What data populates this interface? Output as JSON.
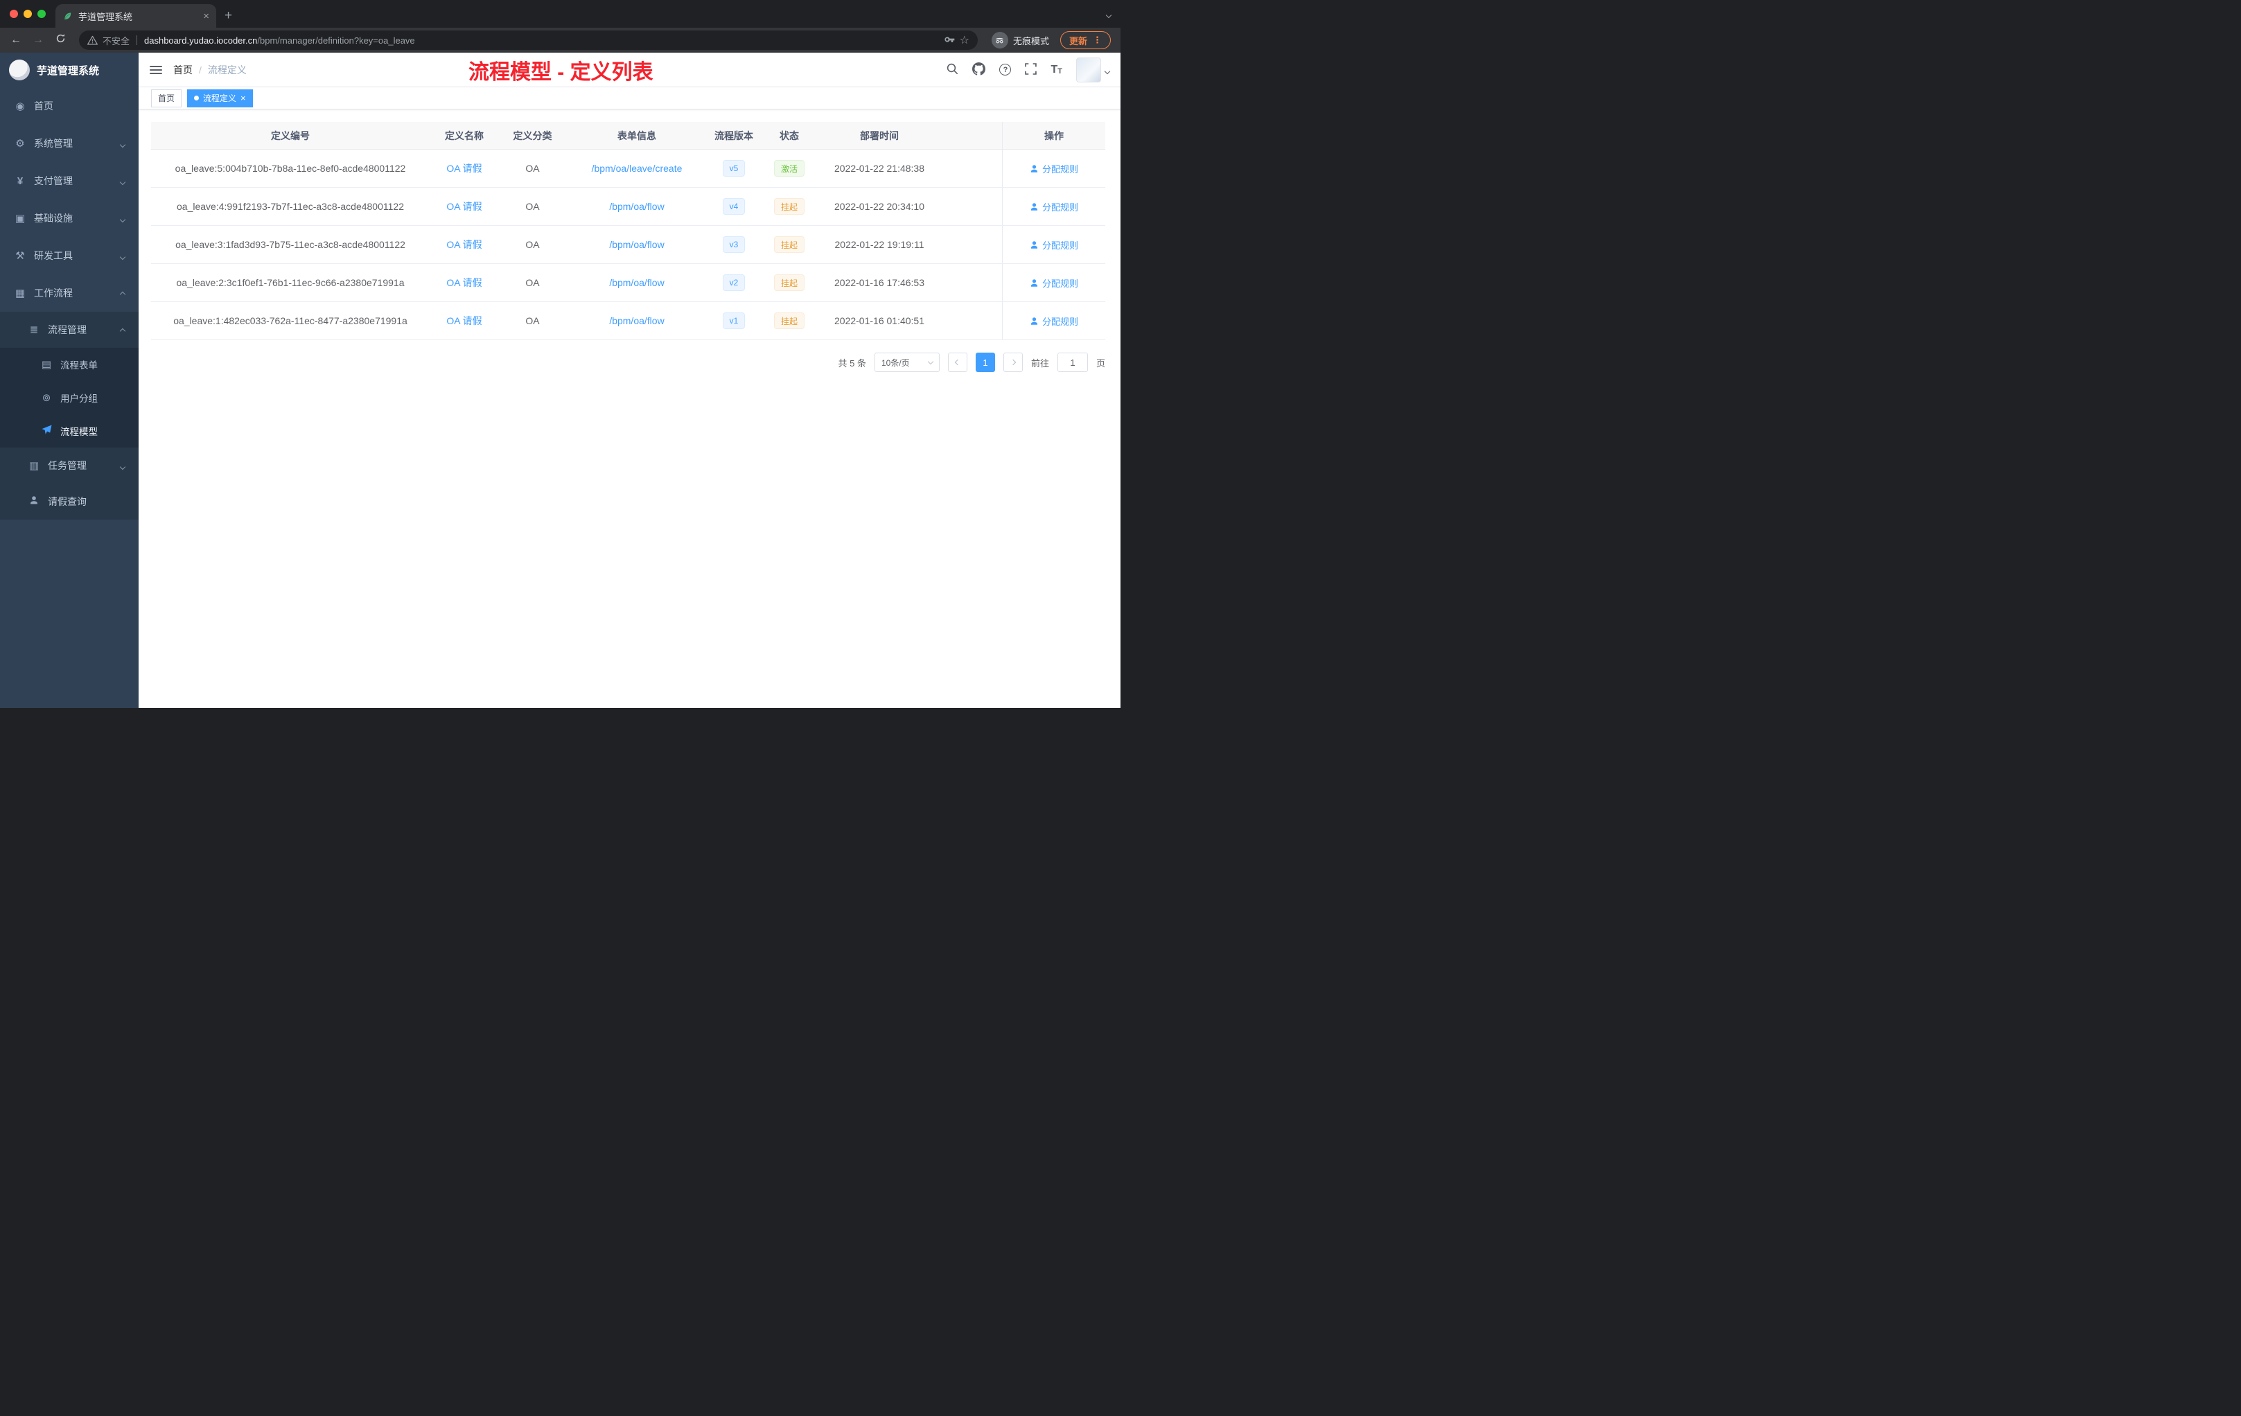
{
  "browser": {
    "tab": {
      "title": "芋道管理系统"
    },
    "address": {
      "security_label": "不安全",
      "url_host": "dashboard.yudao.iocoder.cn",
      "url_path": "/bpm/manager/definition?key=oa_leave",
      "incognito_label": "无痕模式",
      "update_label": "更新"
    }
  },
  "icons": {
    "close": "×",
    "plus": "+",
    "back": "←",
    "forward": "→",
    "star": "☆",
    "dots_vertical": "⋮"
  },
  "sidebar": {
    "logo_title": "芋道管理系统",
    "items": [
      {
        "label": "首页"
      },
      {
        "label": "系统管理"
      },
      {
        "label": "支付管理"
      },
      {
        "label": "基础设施"
      },
      {
        "label": "研发工具"
      },
      {
        "label": "工作流程"
      },
      {
        "label": "流程管理"
      },
      {
        "label": "流程表单"
      },
      {
        "label": "用户分组"
      },
      {
        "label": "流程模型"
      },
      {
        "label": "任务管理"
      },
      {
        "label": "请假查询"
      }
    ]
  },
  "header": {
    "breadcrumb": {
      "home": "首页",
      "separator": "/",
      "current": "流程定义"
    },
    "annotation": "流程模型 - 定义列表"
  },
  "tags": [
    {
      "label": "首页",
      "active": false
    },
    {
      "label": "流程定义",
      "active": true
    }
  ],
  "table": {
    "columns": [
      "定义编号",
      "定义名称",
      "定义分类",
      "表单信息",
      "流程版本",
      "状态",
      "部署时间",
      "操作"
    ],
    "rows": [
      {
        "id": "oa_leave:5:004b710b-7b8a-11ec-8ef0-acde48001122",
        "name": "OA 请假",
        "category": "OA",
        "form": "/bpm/oa/leave/create",
        "version": "v5",
        "status": "激活",
        "status_type": "success",
        "deploy_time": "2022-01-22 21:48:38",
        "action": "分配规则"
      },
      {
        "id": "oa_leave:4:991f2193-7b7f-11ec-a3c8-acde48001122",
        "name": "OA 请假",
        "category": "OA",
        "form": "/bpm/oa/flow",
        "version": "v4",
        "status": "挂起",
        "status_type": "warning",
        "deploy_time": "2022-01-22 20:34:10",
        "action": "分配规则"
      },
      {
        "id": "oa_leave:3:1fad3d93-7b75-11ec-a3c8-acde48001122",
        "name": "OA 请假",
        "category": "OA",
        "form": "/bpm/oa/flow",
        "version": "v3",
        "status": "挂起",
        "status_type": "warning",
        "deploy_time": "2022-01-22 19:19:11",
        "action": "分配规则"
      },
      {
        "id": "oa_leave:2:3c1f0ef1-76b1-11ec-9c66-a2380e71991a",
        "name": "OA 请假",
        "category": "OA",
        "form": "/bpm/oa/flow",
        "version": "v2",
        "status": "挂起",
        "status_type": "warning",
        "deploy_time": "2022-01-16 17:46:53",
        "action": "分配规则"
      },
      {
        "id": "oa_leave:1:482ec033-762a-11ec-8477-a2380e71991a",
        "name": "OA 请假",
        "category": "OA",
        "form": "/bpm/oa/flow",
        "version": "v1",
        "status": "挂起",
        "status_type": "warning",
        "deploy_time": "2022-01-16 01:40:51",
        "action": "分配规则"
      }
    ]
  },
  "pagination": {
    "total_label": "共 5 条",
    "page_size_label": "10条/页",
    "current_page": "1",
    "goto_label": "前往",
    "goto_value": "1",
    "goto_unit": "页"
  },
  "colors": {
    "accent": "#409eff",
    "annotation_red": "#f5222d",
    "success": "#67c23a",
    "warning": "#e6a23c",
    "sidebar_bg": "#304156"
  }
}
